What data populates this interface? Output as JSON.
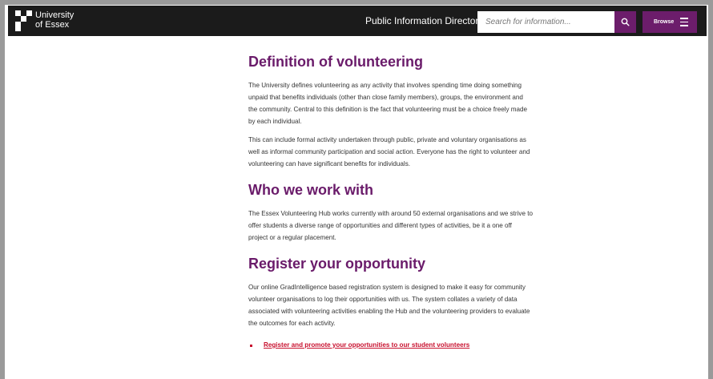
{
  "header": {
    "logo_line1": "University",
    "logo_line2": "of Essex",
    "directory_title": "Public Information Directory",
    "search_placeholder": "Search for information...",
    "search_icon": "search-icon",
    "browse_label": "Browse",
    "menu_icon": "hamburger-menu-icon"
  },
  "colors": {
    "header_bg": "#1b1b1b",
    "brand_purple": "#6c1d6b",
    "heading_purple": "#6a1b6a",
    "link_red": "#c8102e"
  },
  "sections": {
    "definition": {
      "heading": "Definition of volunteering",
      "p1_lines": [
        "The University defines volunteering as any activity that involves spending time doing something",
        "unpaid that benefits individuals (other than close family members), groups, the environment and",
        "the community. Central to this definition is the fact that volunteering must be a choice freely made",
        "by each individual."
      ],
      "p2_lines": [
        "This can include formal activity undertaken through public, private and voluntary organisations as",
        "well as informal community participation and social action. Everyone has the right to volunteer and",
        "volunteering can have significant benefits for individuals."
      ]
    },
    "who": {
      "heading": "Who we work with",
      "p1_lines": [
        "The Essex Volunteering Hub works currently with around 50 external organisations and we strive to",
        "offer students a diverse range of opportunities and different types of activities, be it a one off",
        "project or a regular placement."
      ]
    },
    "register": {
      "heading": "Register your opportunity",
      "p1_lines": [
        "Our online GradIntelligence based registration system is designed to make it easy for community",
        "volunteer organisations to log their opportunities with us. The system collates a variety of data",
        "associated with volunteering activities enabling the Hub and the volunteering providers to evaluate",
        "the outcomes for each activity."
      ],
      "link_label": "Register and promote your opportunities to our student volunteers"
    }
  }
}
